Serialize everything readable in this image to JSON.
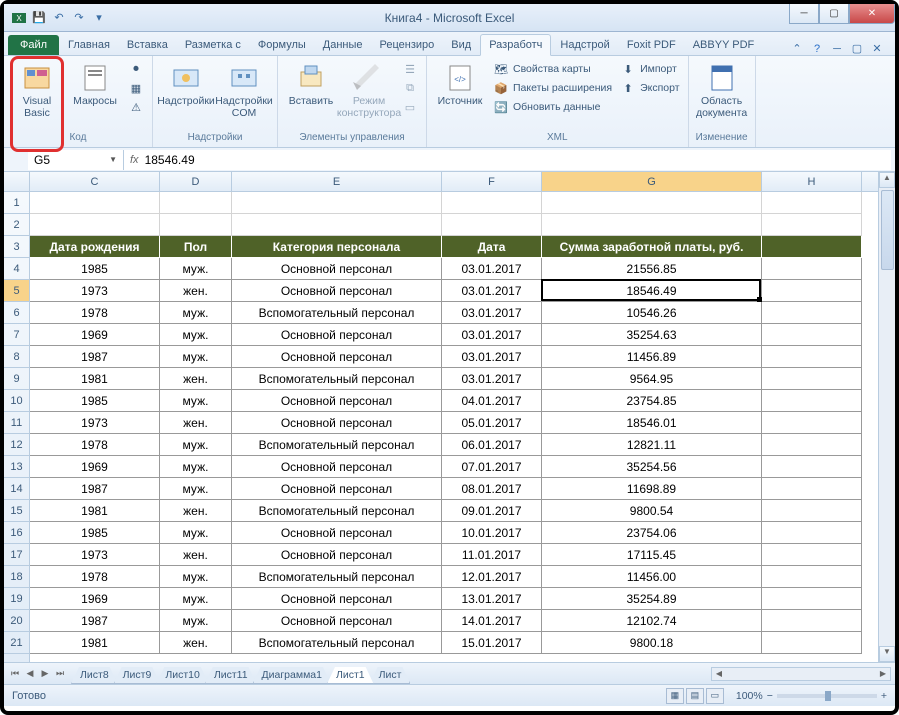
{
  "title": "Книга4  -  Microsoft Excel",
  "tabs": [
    "Главная",
    "Вставка",
    "Разметка с",
    "Формулы",
    "Данные",
    "Рецензиро",
    "Вид",
    "Разработч",
    "Надстрой",
    "Foxit PDF",
    "ABBYY PDF"
  ],
  "file_tab": "Файл",
  "active_tab": "Разработч",
  "ribbon": {
    "vb": "Visual Basic",
    "macros": "Макросы",
    "addins": "Надстройки",
    "comaddins": "Надстройки COM",
    "insert": "Вставить",
    "design": "Режим конструктора",
    "source": "Источник",
    "mapprops": "Свойства карты",
    "expansion": "Пакеты расширения",
    "refresh": "Обновить данные",
    "import": "Импорт",
    "export": "Экспорт",
    "docpanel": "Область документа",
    "grp_code": "Код",
    "grp_addins": "Надстройки",
    "grp_controls": "Элементы управления",
    "grp_xml": "XML",
    "grp_modify": "Изменение"
  },
  "namebox": "G5",
  "formula": "18546.49",
  "colWidths": {
    "C": 130,
    "D": 72,
    "E": 210,
    "F": 100,
    "G": 220,
    "H": 100
  },
  "cols": [
    "C",
    "D",
    "E",
    "F",
    "G",
    "H"
  ],
  "selCol": "G",
  "selRow": 5,
  "headers": {
    "C": "Дата рождения",
    "D": "Пол",
    "E": "Категория персонала",
    "F": "Дата",
    "G": "Сумма заработной платы, руб."
  },
  "rows": [
    {
      "n": 4,
      "C": "1985",
      "D": "муж.",
      "E": "Основной персонал",
      "F": "03.01.2017",
      "G": "21556.85"
    },
    {
      "n": 5,
      "C": "1973",
      "D": "жен.",
      "E": "Основной персонал",
      "F": "03.01.2017",
      "G": "18546.49"
    },
    {
      "n": 6,
      "C": "1978",
      "D": "муж.",
      "E": "Вспомогательный персонал",
      "F": "03.01.2017",
      "G": "10546.26"
    },
    {
      "n": 7,
      "C": "1969",
      "D": "муж.",
      "E": "Основной персонал",
      "F": "03.01.2017",
      "G": "35254.63"
    },
    {
      "n": 8,
      "C": "1987",
      "D": "муж.",
      "E": "Основной персонал",
      "F": "03.01.2017",
      "G": "11456.89"
    },
    {
      "n": 9,
      "C": "1981",
      "D": "жен.",
      "E": "Вспомогательный персонал",
      "F": "03.01.2017",
      "G": "9564.95"
    },
    {
      "n": 10,
      "C": "1985",
      "D": "муж.",
      "E": "Основной персонал",
      "F": "04.01.2017",
      "G": "23754.85"
    },
    {
      "n": 11,
      "C": "1973",
      "D": "жен.",
      "E": "Основной персонал",
      "F": "05.01.2017",
      "G": "18546.01"
    },
    {
      "n": 12,
      "C": "1978",
      "D": "муж.",
      "E": "Вспомогательный персонал",
      "F": "06.01.2017",
      "G": "12821.11"
    },
    {
      "n": 13,
      "C": "1969",
      "D": "муж.",
      "E": "Основной персонал",
      "F": "07.01.2017",
      "G": "35254.56"
    },
    {
      "n": 14,
      "C": "1987",
      "D": "муж.",
      "E": "Основной персонал",
      "F": "08.01.2017",
      "G": "11698.89"
    },
    {
      "n": 15,
      "C": "1981",
      "D": "жен.",
      "E": "Вспомогательный персонал",
      "F": "09.01.2017",
      "G": "9800.54"
    },
    {
      "n": 16,
      "C": "1985",
      "D": "муж.",
      "E": "Основной персонал",
      "F": "10.01.2017",
      "G": "23754.06"
    },
    {
      "n": 17,
      "C": "1973",
      "D": "жен.",
      "E": "Основной персонал",
      "F": "11.01.2017",
      "G": "17115.45"
    },
    {
      "n": 18,
      "C": "1978",
      "D": "муж.",
      "E": "Вспомогательный персонал",
      "F": "12.01.2017",
      "G": "11456.00"
    },
    {
      "n": 19,
      "C": "1969",
      "D": "муж.",
      "E": "Основной персонал",
      "F": "13.01.2017",
      "G": "35254.89"
    },
    {
      "n": 20,
      "C": "1987",
      "D": "муж.",
      "E": "Основной персонал",
      "F": "14.01.2017",
      "G": "12102.74"
    },
    {
      "n": 21,
      "C": "1981",
      "D": "жен.",
      "E": "Вспомогательный персонал",
      "F": "15.01.2017",
      "G": "9800.18"
    }
  ],
  "sheets": [
    "Лист8",
    "Лист9",
    "Лист10",
    "Лист11",
    "Диаграмма1",
    "Лист1",
    "Лист"
  ],
  "active_sheet": "Лист1",
  "status": "Готово",
  "zoom": "100%"
}
